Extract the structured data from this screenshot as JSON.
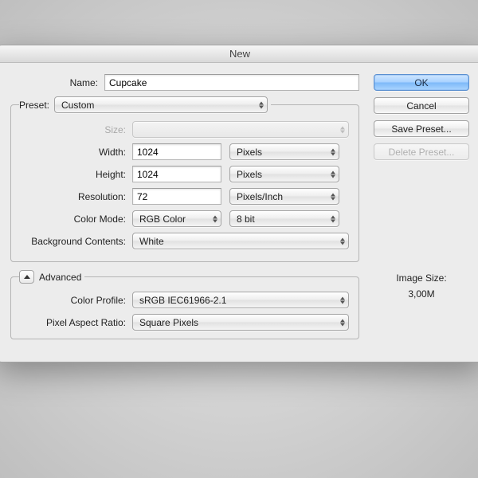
{
  "dialog": {
    "title": "New",
    "name_label": "Name:",
    "name_value": "Cupcake",
    "preset_label": "Preset:",
    "preset_value": "Custom",
    "size_label": "Size:",
    "size_value": "",
    "width_label": "Width:",
    "width_value": "1024",
    "width_unit": "Pixels",
    "height_label": "Height:",
    "height_value": "1024",
    "height_unit": "Pixels",
    "resolution_label": "Resolution:",
    "resolution_value": "72",
    "resolution_unit": "Pixels/Inch",
    "colormode_label": "Color Mode:",
    "colormode_value": "RGB Color",
    "bitdepth_value": "8 bit",
    "bgcontents_label": "Background Contents:",
    "bgcontents_value": "White",
    "advanced_label": "Advanced",
    "colorprofile_label": "Color Profile:",
    "colorprofile_value": "sRGB IEC61966-2.1",
    "par_label": "Pixel Aspect Ratio:",
    "par_value": "Square Pixels"
  },
  "buttons": {
    "ok": "OK",
    "cancel": "Cancel",
    "save_preset": "Save Preset...",
    "delete_preset": "Delete Preset..."
  },
  "info": {
    "image_size_label": "Image Size:",
    "image_size_value": "3,00M"
  }
}
